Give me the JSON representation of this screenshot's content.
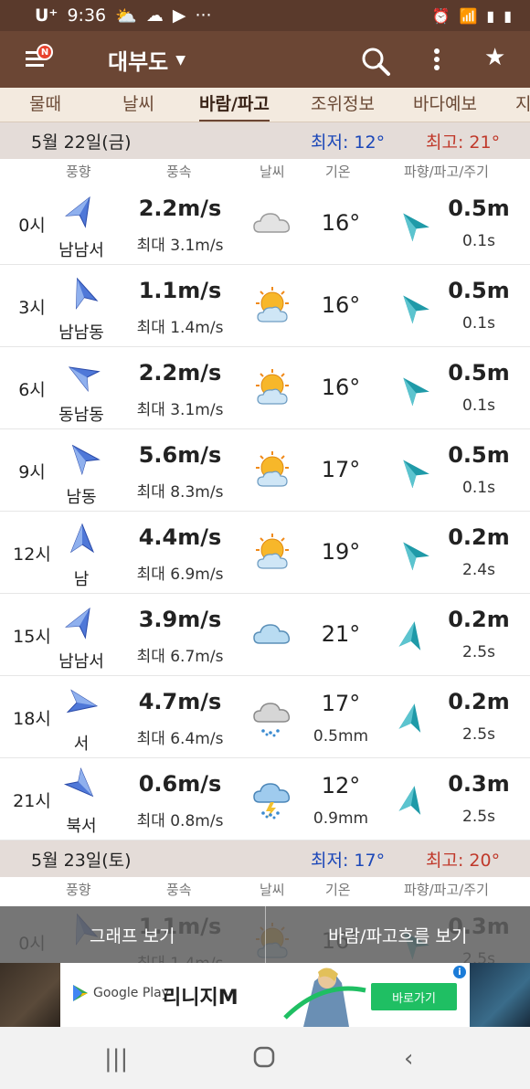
{
  "status_bar": {
    "carrier": "U⁺",
    "time": "9:36",
    "dots": "···"
  },
  "header": {
    "location": "대부도",
    "icons": [
      "menu-icon",
      "search-icon",
      "more-icon",
      "star-icon"
    ],
    "badge": "N"
  },
  "tabs": [
    {
      "label": "물때"
    },
    {
      "label": "날씨"
    },
    {
      "label": "바람/파고",
      "active": true
    },
    {
      "label": "조위정보"
    },
    {
      "label": "바다예보"
    },
    {
      "label": "지"
    }
  ],
  "columns": {
    "direction": "풍향",
    "speed": "풍속",
    "weather": "날씨",
    "temp": "기온",
    "wave": "파향/파고/주기"
  },
  "day1": {
    "date": "5월 22일(금)",
    "min": "최저: 12°",
    "max": "최고: 21°",
    "rows": [
      {
        "time": "0시",
        "dir": "남남서",
        "speed": "2.2m/s",
        "gust": "최대 3.1m/s",
        "weather": "cloud",
        "temp": "16°",
        "rain": "",
        "wave": "0.5m",
        "period": "0.1s"
      },
      {
        "time": "3시",
        "dir": "남남동",
        "speed": "1.1m/s",
        "gust": "최대 1.4m/s",
        "weather": "sun-cloud",
        "temp": "16°",
        "rain": "",
        "wave": "0.5m",
        "period": "0.1s"
      },
      {
        "time": "6시",
        "dir": "동남동",
        "speed": "2.2m/s",
        "gust": "최대 3.1m/s",
        "weather": "sun-cloud",
        "temp": "16°",
        "rain": "",
        "wave": "0.5m",
        "period": "0.1s"
      },
      {
        "time": "9시",
        "dir": "남동",
        "speed": "5.6m/s",
        "gust": "최대 8.3m/s",
        "weather": "sun-cloud",
        "temp": "17°",
        "rain": "",
        "wave": "0.5m",
        "period": "0.1s"
      },
      {
        "time": "12시",
        "dir": "남",
        "speed": "4.4m/s",
        "gust": "최대 6.9m/s",
        "weather": "sun-cloud",
        "temp": "19°",
        "rain": "",
        "wave": "0.2m",
        "period": "2.4s"
      },
      {
        "time": "15시",
        "dir": "남남서",
        "speed": "3.9m/s",
        "gust": "최대 6.7m/s",
        "weather": "cloud-blue",
        "temp": "21°",
        "rain": "",
        "wave": "0.2m",
        "period": "2.5s"
      },
      {
        "time": "18시",
        "dir": "서",
        "speed": "4.7m/s",
        "gust": "최대 6.4m/s",
        "weather": "rain",
        "temp": "17°",
        "rain": "0.5mm",
        "wave": "0.2m",
        "period": "2.5s"
      },
      {
        "time": "21시",
        "dir": "북서",
        "speed": "0.6m/s",
        "gust": "최대 0.8m/s",
        "weather": "storm",
        "temp": "12°",
        "rain": "0.9mm",
        "wave": "0.3m",
        "period": "2.5s"
      }
    ]
  },
  "day2": {
    "date": "5월 23일(토)",
    "min": "최저: 17°",
    "max": "최고: 20°",
    "rows": [
      {
        "time": "0시",
        "dir": "",
        "speed": "1.1m/s",
        "gust": "최대 1.4m/s",
        "weather": "sun-cloud",
        "temp": "16°",
        "rain": "",
        "wave": "0.3m",
        "period": "2.5s"
      }
    ]
  },
  "bottom": {
    "graph": "그래프 보기",
    "flow": "바람/파고흐름 보기"
  },
  "ad": {
    "store": "Google Play",
    "game": "리니지M",
    "cta": "바로가기",
    "info": "i"
  },
  "colors": {
    "status": "#5a3a2c",
    "appbar": "#6b4634",
    "arrow": "#3a64c8",
    "wave_arrow": "#1f9aa8",
    "min": "#1b47b8",
    "max": "#c0392b"
  }
}
